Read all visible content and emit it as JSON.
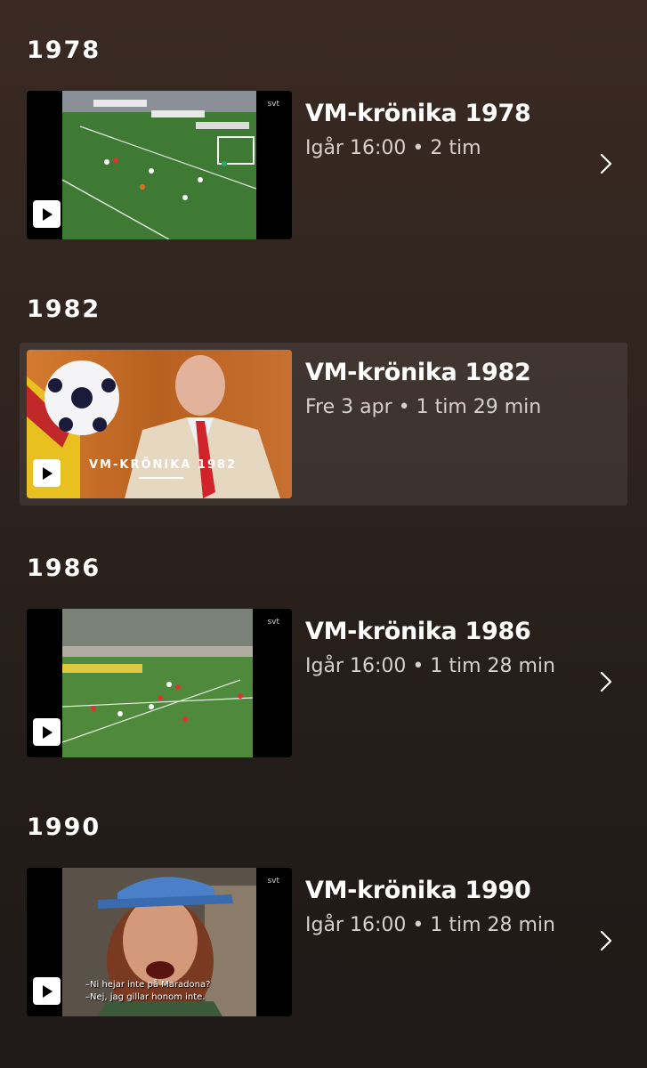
{
  "sections": [
    {
      "year": "1978",
      "title": "VM-krönika 1978",
      "meta": "Igår 16:00 • 2 tim",
      "svt": "svt",
      "thumbnail": "football-match-1978"
    },
    {
      "year": "1982",
      "title": "VM-krönika 1982",
      "meta": "Fre 3 apr • 1 tim 29 min",
      "caption": "VM-KRÖNIKA 1982",
      "thumbnail": "presenter-studio-1982"
    },
    {
      "year": "1986",
      "title": "VM-krönika 1986",
      "meta": "Igår 16:00 • 1 tim 28 min",
      "svt": "svt",
      "thumbnail": "football-match-1986"
    },
    {
      "year": "1990",
      "title": "VM-krönika 1990",
      "meta": "Igår 16:00 • 1 tim 28 min",
      "svt": "svt",
      "subtitle_line1": "–Ni hejar inte på Maradona?",
      "subtitle_line2": "–Nej, jag gillar honom inte.",
      "thumbnail": "fan-interview-1990"
    }
  ],
  "icons": {
    "play": "play-icon",
    "chevron": "chevron-right-icon"
  },
  "colors": {
    "background_top": "#3a2a22",
    "background_bottom": "#1f1a18",
    "highlight": "rgba(255,255,255,0.08)",
    "meta_text": "#d6d0cc"
  }
}
